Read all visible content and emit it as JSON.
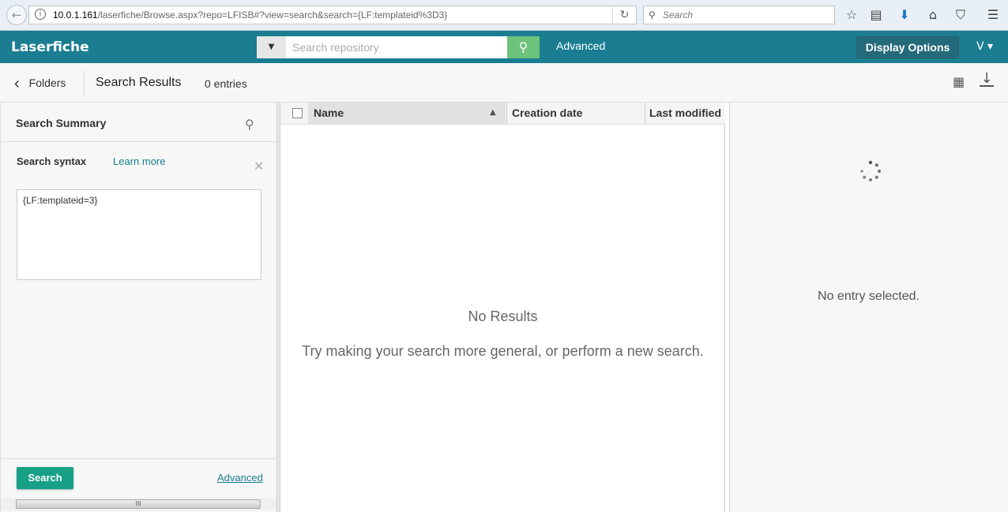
{
  "browser": {
    "url_host": "10.0.1.161",
    "url_path": "/laserfiche/Browse.aspx?repo=LFISB#?view=search&search={LF:templateid%3D3}",
    "search_placeholder": "Search"
  },
  "header": {
    "logo": "Laserfiche",
    "search_placeholder": "Search repository",
    "advanced": "Advanced",
    "display_options": "Display Options",
    "user": "V ▾"
  },
  "toolbar": {
    "back": "Folders",
    "title": "Search Results",
    "count": "0 entries"
  },
  "left": {
    "summary_title": "Search Summary",
    "syntax_label": "Search syntax",
    "learn_more": "Learn more",
    "syntax_value": "{LF:templateid=3}",
    "search_button": "Search",
    "advanced_link": "Advanced"
  },
  "table": {
    "columns": [
      "Name",
      "Creation date",
      "Last modified"
    ],
    "no_results": "No Results",
    "tip": "Try making your search more general, or perform a new search."
  },
  "preview": {
    "empty": "No entry selected."
  },
  "colors": {
    "header": "#1a7d91",
    "search_button": "#16a085",
    "go_button": "#6cc37a"
  }
}
